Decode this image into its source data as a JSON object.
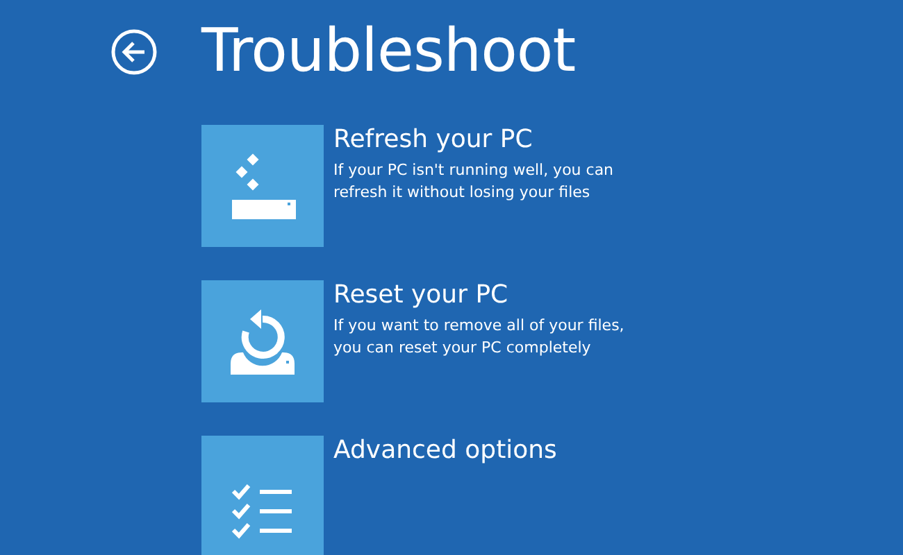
{
  "title": "Troubleshoot",
  "options": [
    {
      "kind": "refresh",
      "title": "Refresh your PC",
      "description": "If your PC isn't running well, you can refresh it without losing your files"
    },
    {
      "kind": "reset",
      "title": "Reset your PC",
      "description": "If you want to remove all of your files, you can reset your PC completely"
    },
    {
      "kind": "advanced",
      "title": "Advanced options"
    }
  ]
}
